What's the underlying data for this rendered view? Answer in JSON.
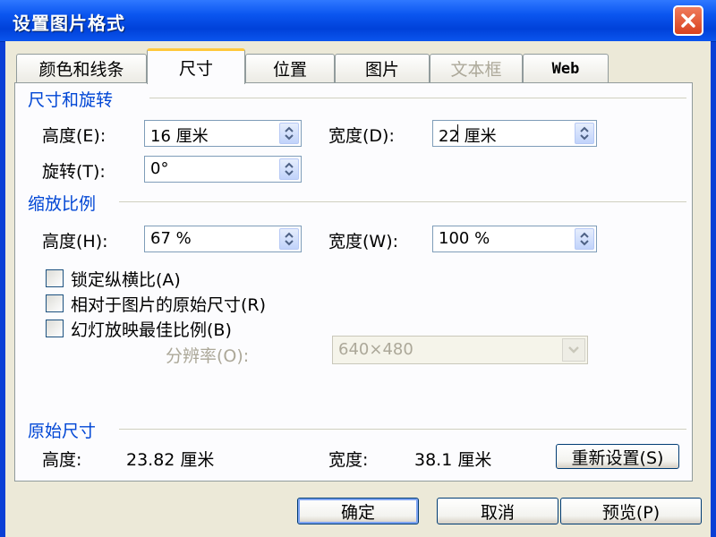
{
  "window": {
    "title": "设置图片格式"
  },
  "tabs": [
    {
      "label": "颜色和线条"
    },
    {
      "label": "尺寸"
    },
    {
      "label": "位置"
    },
    {
      "label": "图片"
    },
    {
      "label": "文本框"
    },
    {
      "label": "Web"
    }
  ],
  "size_rotation": {
    "group_label": "尺寸和旋转",
    "height_label": "高度(E):",
    "height_value": "16 厘米",
    "width_label": "宽度(D):",
    "width_value": "22 厘米",
    "rotation_label": "旋转(T):",
    "rotation_value": "0°"
  },
  "scale": {
    "group_label": "缩放比例",
    "height_label": "高度(H):",
    "height_value": "67 %",
    "width_label": "宽度(W):",
    "width_value": "100 %",
    "checkboxes": [
      {
        "label": "锁定纵横比(A)",
        "checked": false
      },
      {
        "label": "相对于图片的原始尺寸(R)",
        "checked": false
      },
      {
        "label": "幻灯放映最佳比例(B)",
        "checked": false
      }
    ],
    "resolution_label": "分辨率(O):",
    "resolution_value": "640×480"
  },
  "original": {
    "group_label": "原始尺寸",
    "height_label": "高度:",
    "height_value": "23.82 厘米",
    "width_label": "宽度:",
    "width_value": "38.1 厘米",
    "reset_label": "重新设置(S)"
  },
  "buttons": {
    "ok": "确定",
    "cancel": "取消",
    "preview": "预览(P)"
  },
  "colors": {
    "title_bar": "#0a3fd6",
    "accent_text": "#0046d5",
    "close_button": "#d9411f"
  }
}
